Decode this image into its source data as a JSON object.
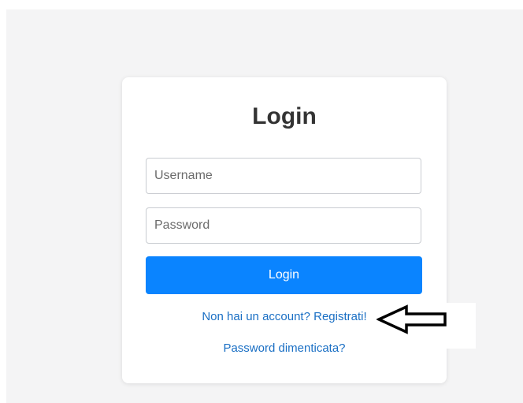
{
  "login": {
    "title": "Login",
    "username_placeholder": "Username",
    "password_placeholder": "Password",
    "submit_label": "Login",
    "register_link": "Non hai un account? Registrati!",
    "forgot_link": "Password dimenticata?"
  },
  "annotation": {
    "icon": "left-arrow-icon",
    "color": "#000000"
  },
  "theme": {
    "accent": "#0a84ff",
    "link": "#1a6fc4",
    "background": "#f4f4f5"
  }
}
